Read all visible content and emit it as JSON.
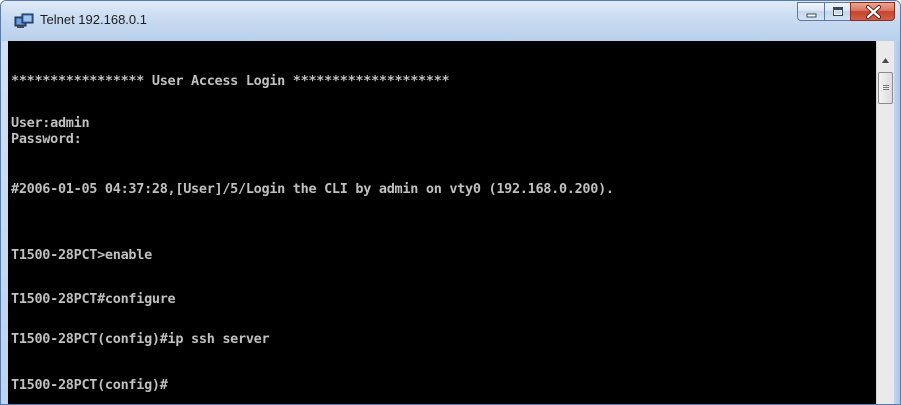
{
  "window": {
    "title": "Telnet 192.168.0.1",
    "app_icon": "telnet-terminal-icon",
    "caption_icons": [
      "minimize-icon",
      "maximize-icon",
      "close-icon"
    ]
  },
  "console": {
    "lines": [
      "***************** User Access Login ********************",
      "",
      "User:admin",
      "Password:",
      "",
      "#2006-01-05 04:37:28,[User]/5/Login the CLI by admin on vty0 (192.168.0.200).",
      "",
      "",
      "T1500-28PCT>enable",
      "",
      "T1500-28PCT#configure",
      "",
      "T1500-28PCT(config)#ip ssh server",
      "",
      "T1500-28PCT(config)#"
    ],
    "text_color": "#c0c0c0",
    "background": "#000000"
  },
  "scrollbar": {
    "up_icon": "arrow-up-icon"
  }
}
